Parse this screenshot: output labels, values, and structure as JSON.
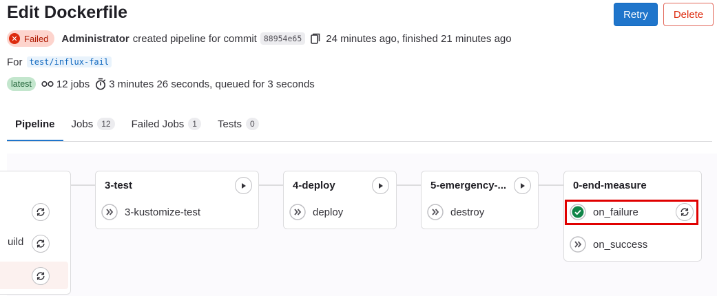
{
  "header": {
    "title": "Edit Dockerfile",
    "retry_label": "Retry",
    "delete_label": "Delete"
  },
  "pipeline": {
    "status": "Failed",
    "author": "Administrator",
    "action_text": "created pipeline for commit",
    "commit_sha": "88954e65",
    "timing": "24 minutes ago, finished 21 minutes ago",
    "for_label": "For",
    "ref": "test/influx-fail",
    "latest_badge": "latest",
    "jobs_count_text": "12 jobs",
    "duration_text": "3 minutes 26 seconds, queued for 3 seconds"
  },
  "tabs": [
    {
      "label": "Pipeline"
    },
    {
      "label": "Jobs",
      "count": "12"
    },
    {
      "label": "Failed Jobs",
      "count": "1"
    },
    {
      "label": "Tests",
      "count": "0"
    }
  ],
  "stages": {
    "partial": {
      "job_partial": "uild"
    },
    "test": {
      "title": "3-test",
      "jobs": [
        {
          "name": "3-kustomize-test",
          "status": "manual"
        }
      ]
    },
    "deploy": {
      "title": "4-deploy",
      "jobs": [
        {
          "name": "deploy",
          "status": "manual"
        }
      ]
    },
    "emergency": {
      "title": "5-emergency-...",
      "jobs": [
        {
          "name": "destroy",
          "status": "manual"
        }
      ]
    },
    "end_measure": {
      "title": "0-end-measure",
      "jobs": [
        {
          "name": "on_failure",
          "status": "success"
        },
        {
          "name": "on_success",
          "status": "manual"
        }
      ]
    }
  },
  "colors": {
    "primary": "#1f75cb",
    "danger": "#dd2b0e",
    "success": "#108548",
    "highlight": "#e00000"
  },
  "icons": {
    "status": "x-circle-icon",
    "copy": "copy-icon",
    "jobs": "pipeline-icon",
    "duration": "timer-icon",
    "play": "play-icon",
    "retry": "retry-icon",
    "manual": "double-chevron-icon",
    "success": "check-circle-icon"
  }
}
